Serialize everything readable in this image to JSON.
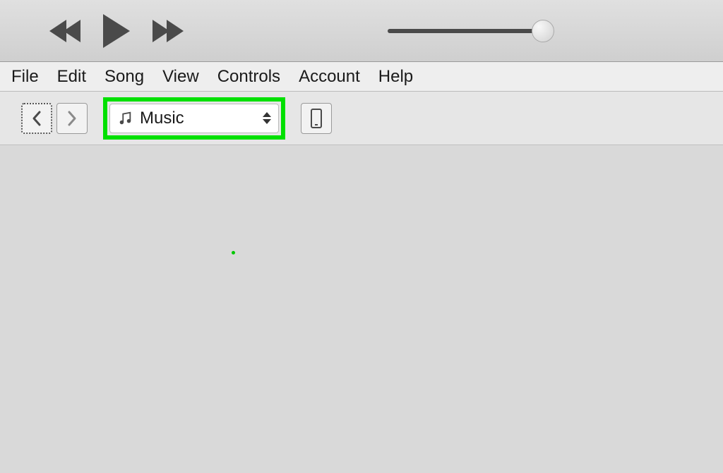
{
  "menu": {
    "file": "File",
    "edit": "Edit",
    "song": "Song",
    "view": "View",
    "controls": "Controls",
    "account": "Account",
    "help": "Help"
  },
  "toolbar": {
    "media_selector_label": "Music"
  }
}
